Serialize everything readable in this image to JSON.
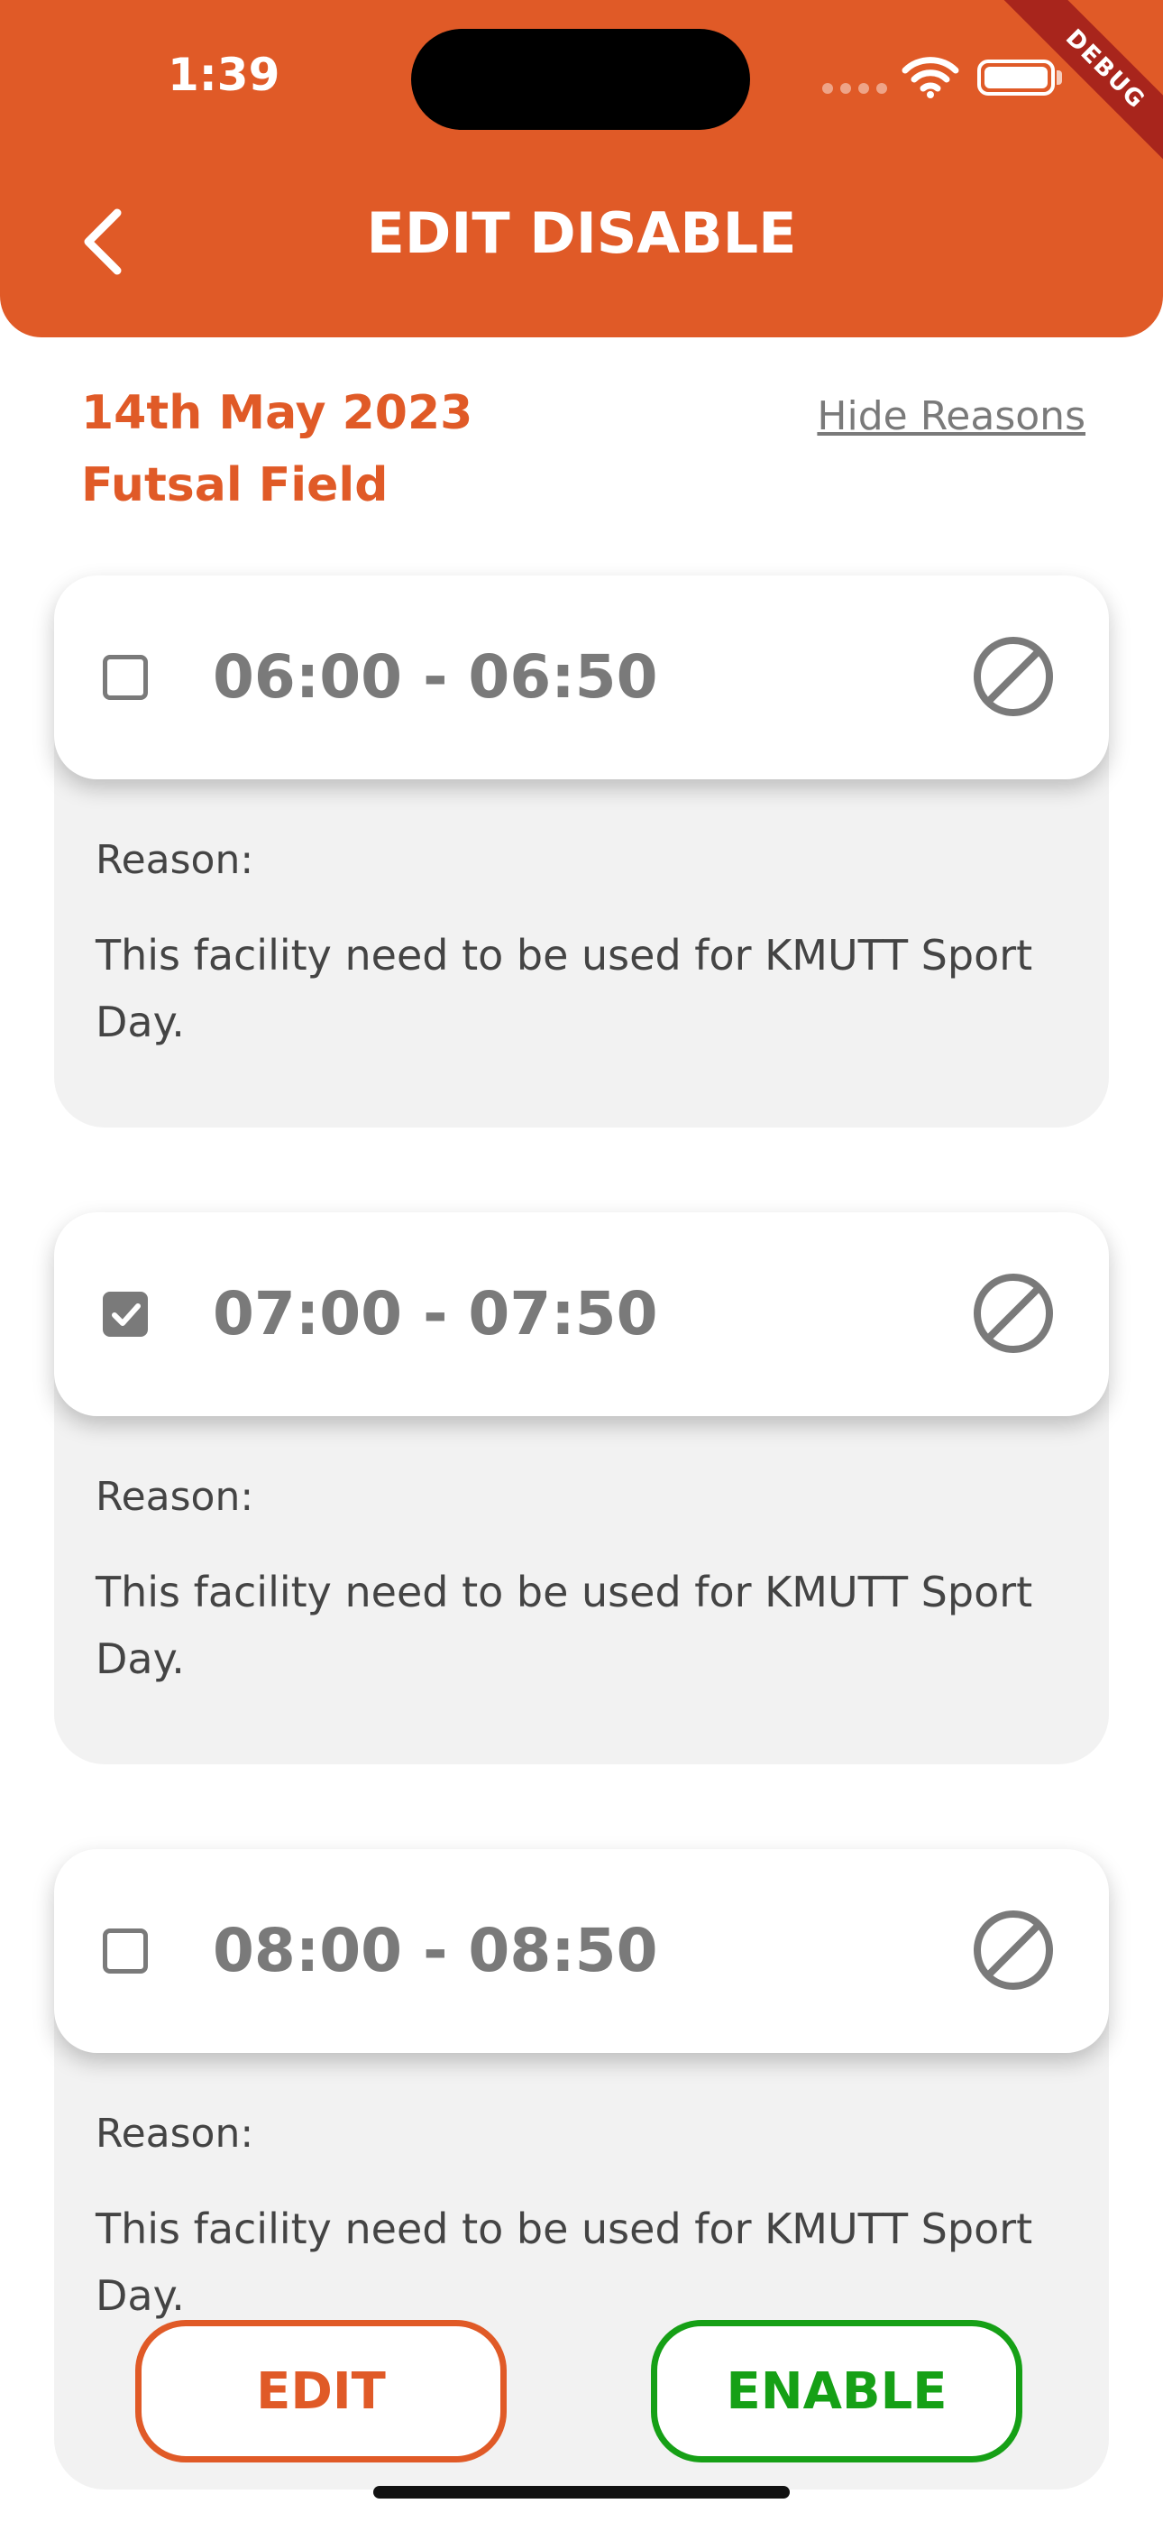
{
  "status_bar": {
    "time": "1:39",
    "debug_label": "DEBUG"
  },
  "header": {
    "title": "EDIT DISABLE",
    "back_icon": "chevron-left-icon",
    "color": "#e05a27"
  },
  "info": {
    "date": "14th May 2023",
    "facility": "Futsal Field",
    "hide_reasons_label": "Hide Reasons"
  },
  "slots": [
    {
      "time": "06:00 - 06:50",
      "checked": false,
      "reason_label": "Reason:",
      "reason_text": "This facility need to be used for KMUTT Sport Day."
    },
    {
      "time": "07:00 - 07:50",
      "checked": true,
      "reason_label": "Reason:",
      "reason_text": "This facility need to be used for KMUTT Sport Day."
    },
    {
      "time": "08:00 - 08:50",
      "checked": false,
      "reason_label": "Reason:",
      "reason_text": "This facility need to be used for KMUTT Sport Day."
    }
  ],
  "actions": {
    "edit_label": "EDIT",
    "enable_label": "ENABLE",
    "edit_color": "#e05a27",
    "enable_color": "#16a016"
  }
}
